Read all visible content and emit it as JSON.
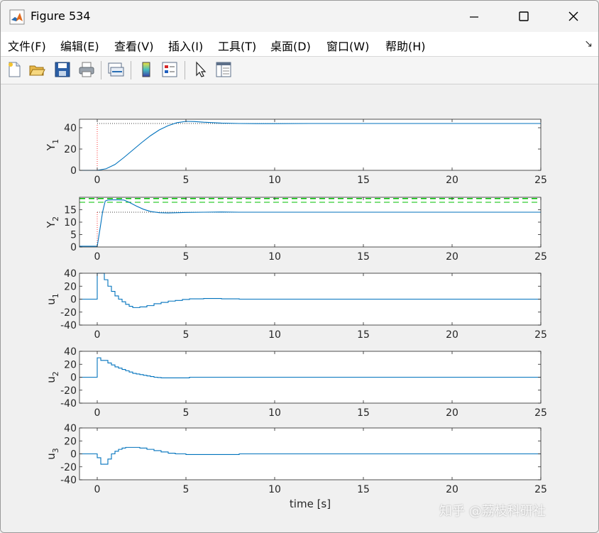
{
  "window": {
    "title": "Figure 534",
    "controls": {
      "minimize": "—",
      "maximize": "☐",
      "close": "✕"
    }
  },
  "menubar": {
    "items": [
      "文件(F)",
      "编辑(E)",
      "查看(V)",
      "插入(I)",
      "工具(T)",
      "桌面(D)",
      "窗口(W)",
      "帮助(H)"
    ],
    "dock_icon": "↘"
  },
  "toolbar": {
    "buttons": [
      "new-figure-icon",
      "open-file-icon",
      "save-icon",
      "print-icon",
      "link-plot-icon",
      "colorbar-icon",
      "legend-icon",
      "pointer-icon",
      "property-inspector-icon"
    ]
  },
  "watermark": "知乎 @荔枝科研社",
  "colors": {
    "line": "#0072bd",
    "reference_red": "#ff0000",
    "setpoint_dotted": "#000000",
    "constraint_green": "#00c000"
  },
  "chart_data": [
    {
      "type": "line",
      "ylabel_main": "Y",
      "ylabel_sub": "1",
      "xlim": [
        -1,
        25
      ],
      "ylim": [
        0,
        48
      ],
      "yticks": [
        0,
        20,
        40
      ],
      "xticks": [
        0,
        5,
        10,
        15,
        20,
        25
      ],
      "x": [
        -1,
        0,
        0.5,
        1,
        1.5,
        2,
        2.5,
        3,
        3.5,
        4,
        4.5,
        5,
        5.5,
        6,
        7,
        8,
        9,
        10,
        12,
        15,
        20,
        25
      ],
      "y": [
        0,
        0,
        1.5,
        5.5,
        12,
        19,
        26,
        32.5,
        38,
        42,
        44.8,
        46,
        45.8,
        45.2,
        44.4,
        44,
        43.9,
        43.9,
        44,
        44,
        44,
        44
      ],
      "reference_level": 44,
      "step_time": 0
    },
    {
      "type": "line",
      "ylabel_main": "Y",
      "ylabel_sub": "2",
      "xlim": [
        -1,
        25
      ],
      "ylim": [
        0,
        20
      ],
      "yticks": [
        0,
        5,
        10,
        15
      ],
      "xticks": [
        0,
        5,
        10,
        15,
        20,
        25
      ],
      "x": [
        -1,
        0,
        0.15,
        0.3,
        0.45,
        0.6,
        1.0,
        1.5,
        1.8,
        2.2,
        2.6,
        3.0,
        3.5,
        4,
        5,
        6,
        7,
        8,
        10,
        15,
        20,
        25
      ],
      "y": [
        0.3,
        0.3,
        7,
        14,
        18.5,
        18.9,
        19,
        18.9,
        18,
        16.5,
        15.2,
        14.3,
        13.8,
        13.7,
        13.9,
        14,
        14.1,
        14,
        14,
        14,
        14,
        14
      ],
      "reference_level": 14,
      "upper_bound": 19.5,
      "upper_bound_2": 18,
      "step_time": 0
    },
    {
      "type": "line",
      "ylabel_main": "u",
      "ylabel_sub": "1",
      "xlim": [
        -1,
        25
      ],
      "ylim": [
        -40,
        40
      ],
      "yticks": [
        -40,
        -20,
        0,
        20,
        40
      ],
      "xticks": [
        0,
        5,
        10,
        15,
        20,
        25
      ],
      "x": [
        -1,
        0,
        0.4,
        0.6,
        0.8,
        1.0,
        1.2,
        1.4,
        1.6,
        1.8,
        2.0,
        2.4,
        2.8,
        3.2,
        3.6,
        4.0,
        4.4,
        4.8,
        5.2,
        6.0,
        7.0,
        8.0,
        10.0,
        15.0,
        25.0
      ],
      "y": [
        0,
        40,
        30,
        20,
        12,
        5,
        0,
        -4,
        -8,
        -11,
        -13,
        -12,
        -10,
        -7,
        -5,
        -3,
        -2,
        -0.5,
        0.5,
        1,
        0.5,
        0,
        0,
        0,
        0
      ],
      "step_plot": true
    },
    {
      "type": "line",
      "ylabel_main": "u",
      "ylabel_sub": "2",
      "xlim": [
        -1,
        25
      ],
      "ylim": [
        -40,
        40
      ],
      "yticks": [
        -40,
        -20,
        0,
        20,
        40
      ],
      "xticks": [
        0,
        5,
        10,
        15,
        20,
        25
      ],
      "x": [
        -1,
        0,
        0.2,
        0.6,
        0.8,
        1.0,
        1.2,
        1.4,
        1.6,
        1.8,
        2.0,
        2.2,
        2.4,
        2.6,
        2.8,
        3.0,
        3.2,
        3.4,
        3.6,
        4.4,
        5.2,
        6.0,
        25.0
      ],
      "y": [
        0,
        30,
        26,
        22,
        19,
        16,
        14,
        12,
        10,
        8,
        6,
        5,
        4,
        3,
        2,
        1,
        0,
        -0.5,
        -1,
        -1,
        0,
        0,
        0
      ],
      "step_plot": true
    },
    {
      "type": "line",
      "ylabel_main": "u",
      "ylabel_sub": "3",
      "xlim": [
        -1,
        25
      ],
      "ylim": [
        -40,
        40
      ],
      "yticks": [
        -40,
        -20,
        0,
        20,
        40
      ],
      "xticks": [
        0,
        5,
        10,
        15,
        20,
        25
      ],
      "xlabel": "time [s]",
      "x": [
        -1,
        0,
        0.2,
        0.6,
        0.8,
        1.0,
        1.2,
        1.4,
        1.6,
        2.0,
        2.4,
        2.8,
        3.2,
        3.6,
        4.0,
        4.4,
        5.0,
        6.0,
        8.0,
        10.0,
        15.0,
        25.0
      ],
      "y": [
        0,
        -6,
        -16,
        -8,
        0,
        4,
        7,
        9,
        10,
        10,
        9,
        7,
        5,
        3,
        1,
        0,
        -1,
        -1,
        0,
        0,
        0,
        0
      ],
      "step_plot": true
    }
  ]
}
